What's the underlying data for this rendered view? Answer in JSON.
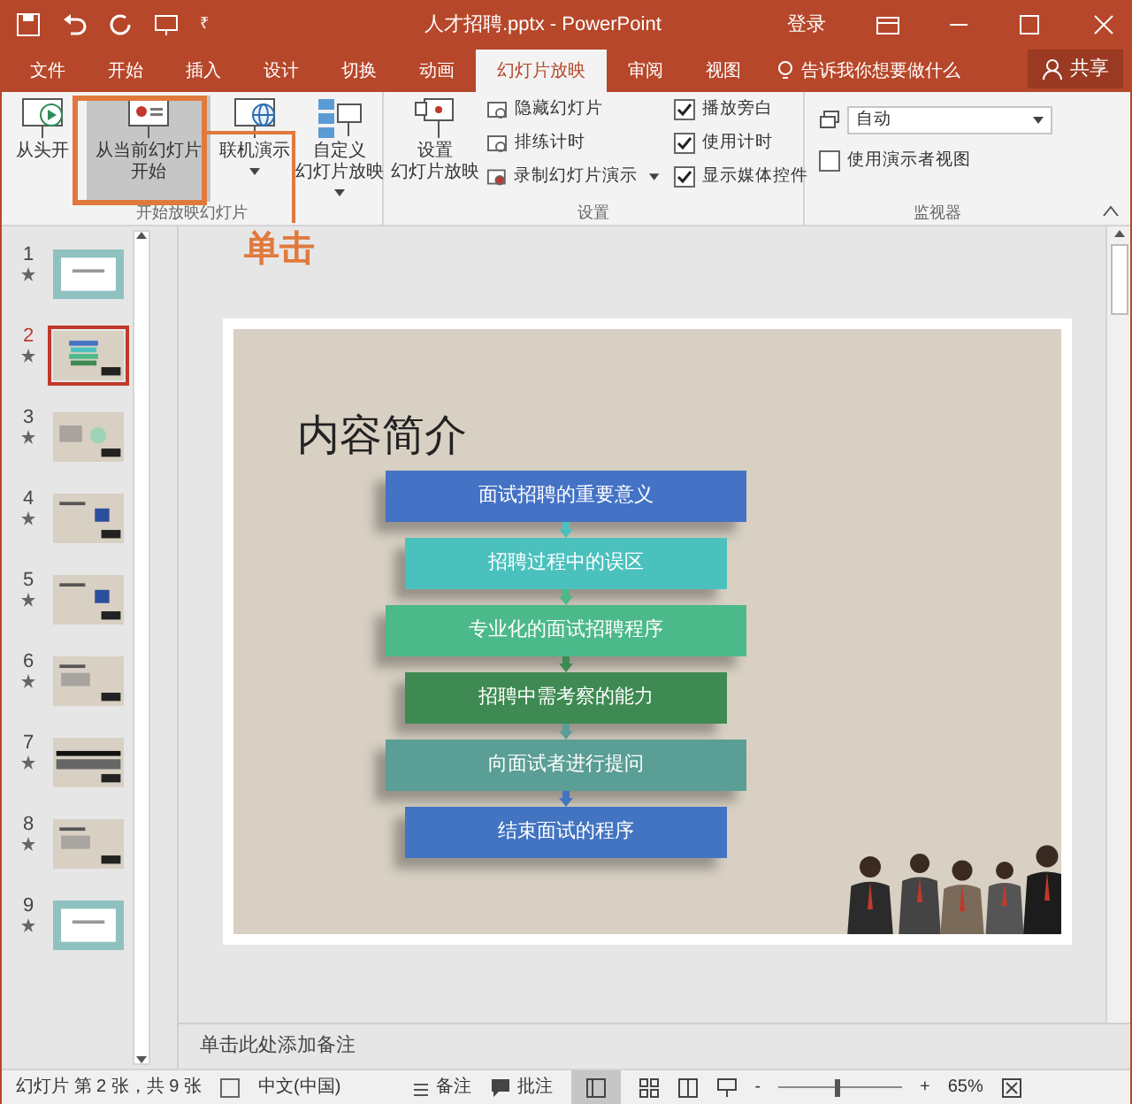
{
  "window": {
    "title": "人才招聘.pptx - PowerPoint",
    "sign_in": "登录"
  },
  "quick_access": {
    "customize": "₹"
  },
  "tabs": [
    {
      "label": "文件",
      "selected": false
    },
    {
      "label": "开始",
      "selected": false
    },
    {
      "label": "插入",
      "selected": false
    },
    {
      "label": "设计",
      "selected": false
    },
    {
      "label": "切换",
      "selected": false
    },
    {
      "label": "动画",
      "selected": false
    },
    {
      "label": "幻灯片放映",
      "selected": true
    },
    {
      "label": "审阅",
      "selected": false
    },
    {
      "label": "视图",
      "selected": false
    }
  ],
  "tell_me": "告诉我你想要做什么",
  "share": "共享",
  "ribbon": {
    "start_group": {
      "label": "开始放映幻灯片",
      "buttons": [
        {
          "lines": [
            "从头开"
          ],
          "selected": false,
          "dropdown": false
        },
        {
          "lines": [
            "从当前幻灯片",
            "开始"
          ],
          "selected": true,
          "dropdown": false
        },
        {
          "lines": [
            "联机演示"
          ],
          "selected": false,
          "dropdown": true
        },
        {
          "lines": [
            "自定义",
            "幻灯片放映"
          ],
          "selected": false,
          "dropdown": true
        }
      ]
    },
    "setup_group": {
      "label": "设置",
      "big_lines": [
        "设置",
        "幻灯片放映"
      ],
      "small": [
        {
          "label": "隐藏幻灯片",
          "dropdown": false
        },
        {
          "label": "排练计时",
          "dropdown": false
        },
        {
          "label": "录制幻灯片演示",
          "dropdown": true
        }
      ],
      "checks": [
        {
          "label": "播放旁白",
          "checked": true
        },
        {
          "label": "使用计时",
          "checked": true
        },
        {
          "label": "显示媒体控件",
          "checked": true
        }
      ]
    },
    "monitor_group": {
      "label": "监视器",
      "monitor": "自动",
      "presenter_view": {
        "label": "使用演示者视图",
        "checked": false
      }
    }
  },
  "annotation": "单击",
  "slides": [
    {
      "number": "1",
      "kind": "pattern",
      "selected": false
    },
    {
      "number": "2",
      "kind": "list",
      "selected": true
    },
    {
      "number": "3",
      "kind": "diagram",
      "selected": false
    },
    {
      "number": "4",
      "selected": false
    },
    {
      "number": "5",
      "selected": false
    },
    {
      "number": "6",
      "kind": "text",
      "selected": false
    },
    {
      "number": "7",
      "kind": "table",
      "selected": false
    },
    {
      "number": "8",
      "kind": "text",
      "selected": false
    },
    {
      "number": "9",
      "kind": "pattern",
      "selected": false
    }
  ],
  "slide": {
    "title": "内容简介",
    "steps": [
      {
        "text": "面试招聘的重要意义",
        "color": "#4472c4",
        "wide": true
      },
      {
        "text": "招聘过程中的误区",
        "color": "#4bc1be",
        "wide": false
      },
      {
        "text": "专业化的面试招聘程序",
        "color": "#4cb98a",
        "wide": true
      },
      {
        "text": "招聘中需考察的能力",
        "color": "#3e8a52",
        "wide": false
      },
      {
        "text": "向面试者进行提问",
        "color": "#5a9e95",
        "wide": true
      },
      {
        "text": "结束面试的程序",
        "color": "#4274c2",
        "wide": false
      }
    ]
  },
  "notes": {
    "placeholder": "单击此处添加备注"
  },
  "status_bar": {
    "slide_info": "幻灯片 第 2 张，共 9 张",
    "language": "中文(中国)",
    "notes": "备注",
    "comments": "批注",
    "zoom": "65%",
    "level": 0.45,
    "zoom_minus": "-",
    "zoom_plus": "+"
  }
}
